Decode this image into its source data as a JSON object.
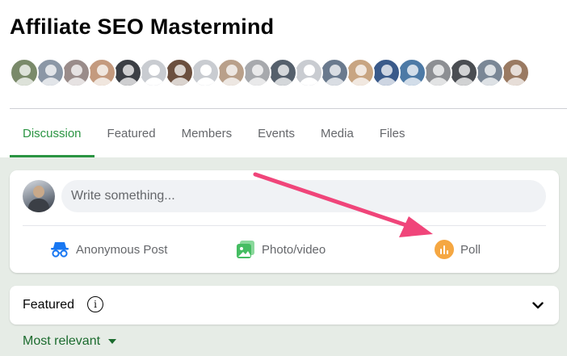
{
  "group": {
    "title": "Affiliate SEO Mastermind"
  },
  "members": [
    {
      "color": "#7a8a6a"
    },
    {
      "color": "#8b97a6"
    },
    {
      "color": "#9a8c8a"
    },
    {
      "color": "#c49a7e"
    },
    {
      "color": "#3c3f45"
    },
    {
      "color": "generic"
    },
    {
      "color": "#6b4f3e"
    },
    {
      "color": "generic"
    },
    {
      "color": "#b9a08a"
    },
    {
      "color": "#a7a9ad"
    },
    {
      "color": "#55606c"
    },
    {
      "color": "generic"
    },
    {
      "color": "#6a7a8e"
    },
    {
      "color": "#c8a582"
    },
    {
      "color": "#3a5a8a"
    },
    {
      "color": "#4d7aa6"
    },
    {
      "color": "#8d8f93"
    },
    {
      "color": "#4a4d52"
    },
    {
      "color": "#7a8796"
    },
    {
      "color": "#9a7a62"
    }
  ],
  "tabs": [
    {
      "label": "Discussion",
      "active": true
    },
    {
      "label": "Featured"
    },
    {
      "label": "Members"
    },
    {
      "label": "Events"
    },
    {
      "label": "Media"
    },
    {
      "label": "Files"
    }
  ],
  "composer": {
    "placeholder": "Write something...",
    "actions": {
      "anonymous": {
        "label": "Anonymous Post",
        "icon": "incognito-icon"
      },
      "photo": {
        "label": "Photo/video",
        "icon": "photo-icon"
      },
      "poll": {
        "label": "Poll",
        "icon": "poll-icon"
      }
    }
  },
  "featured": {
    "label": "Featured"
  },
  "sort": {
    "label": "Most relevant"
  },
  "colors": {
    "accent": "#2a9442",
    "arrow": "#f0457a",
    "poll": "#f5a742",
    "photo": "#45bd62",
    "anonymous": "#1877f2"
  }
}
